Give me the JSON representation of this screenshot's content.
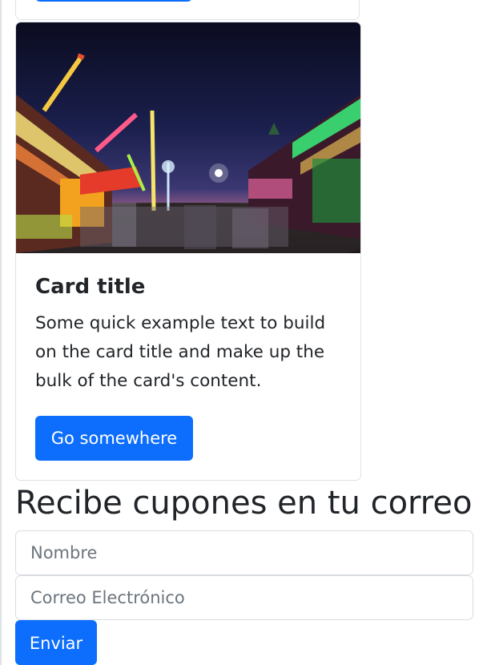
{
  "card": {
    "image_alt": "Night carnival with illuminated rides and crowd",
    "title": "Card title",
    "text": "Some quick example text to build on the card title and make up the bulk of the card's content.",
    "button_label": "Go somewhere"
  },
  "newsletter": {
    "heading": "Recibe cupones en tu correo",
    "name_placeholder": "Nombre",
    "email_placeholder": "Correo Electrónico",
    "submit_label": "Enviar"
  },
  "colors": {
    "primary": "#0d6efd",
    "text": "#212529",
    "border": "#dfe2e6",
    "placeholder": "#6c757d"
  }
}
